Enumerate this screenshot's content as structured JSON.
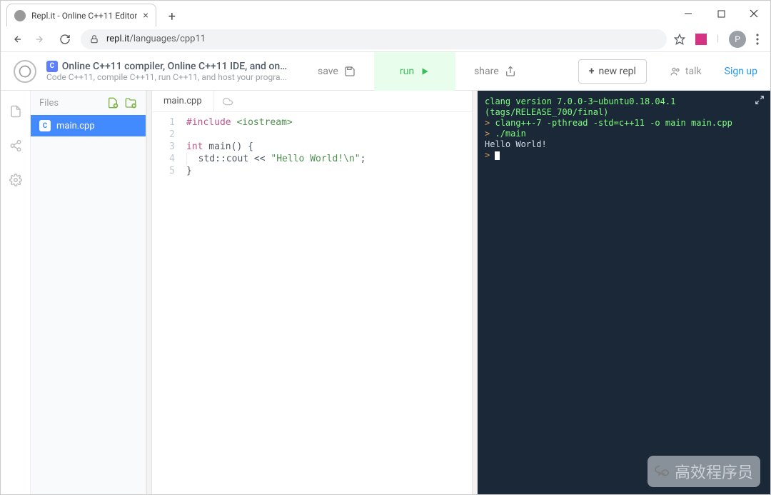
{
  "browser": {
    "tab_title": "Repl.it - Online C++11 Editor",
    "url_host": "repl.it",
    "url_path": "/languages/cpp11",
    "avatar_letter": "P"
  },
  "header": {
    "title": "Online C++11 compiler, Online C++11 IDE, and onli...",
    "subtitle": "Code C++11, compile C++11, run C++11, and host your progra...",
    "save_label": "save",
    "run_label": "run",
    "share_label": "share",
    "new_repl_label": "new repl",
    "talk_label": "talk",
    "signup_label": "Sign up"
  },
  "sidebar": {
    "files_label": "Files",
    "items": [
      {
        "name": "main.cpp",
        "active": true
      }
    ]
  },
  "editor": {
    "tabname": "main.cpp",
    "save_status": "saved",
    "code": {
      "l1_include": "#include",
      "l1_ios": "<iostream>",
      "l3_int": "int",
      "l3_rest": " main() {",
      "l4_indent": "  std::cout << ",
      "l4_str": "\"Hello World!\\n\"",
      "l4_end": ";",
      "l5": "}"
    },
    "line_count": 5
  },
  "terminal": {
    "linesA": "clang version 7.0.0-3~ubuntu0.18.04.1 (tags/RELEASE_700/final)",
    "prompt": ">",
    "cmd1": "clang++-7 -pthread -std=c++11 -o main main.cpp",
    "cmd2": "./main",
    "out1": "Hello World!"
  },
  "watermark": "高效程序员"
}
